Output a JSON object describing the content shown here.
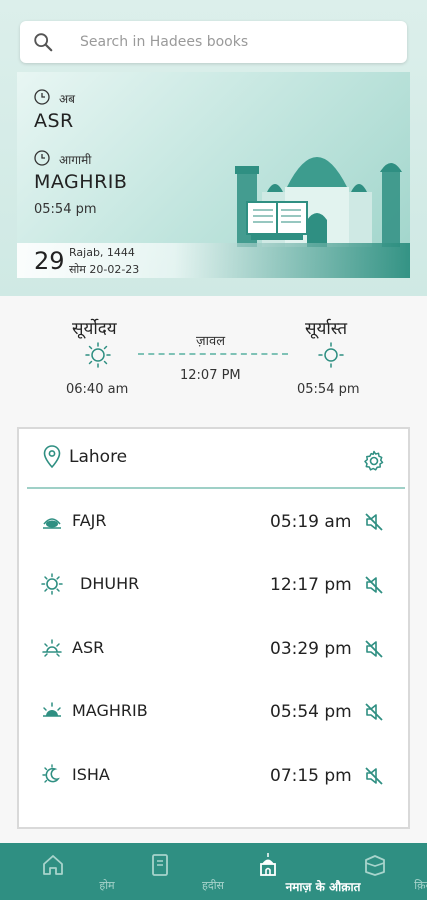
{
  "search": {
    "placeholder": "Search in Hadees books"
  },
  "card": {
    "now_label": "अब",
    "now_prayer": "ASR",
    "next_label": "आगामी",
    "next_prayer": "MAGHRIB",
    "next_time": "05:54 pm",
    "day": "29",
    "hijri": "Rajab, 1444",
    "gregorian": "सोम 20-02-23"
  },
  "sun": {
    "sunrise_label": "सूर्योदय",
    "sunrise_time": "06:40 am",
    "zawal_label": "ज़ावल",
    "zawal_time": "12:07 PM",
    "sunset_label": "सूर्यास्त",
    "sunset_time": "05:54 pm"
  },
  "location": {
    "name": "Lahore"
  },
  "prayers": [
    {
      "name": "FAJR",
      "time": "05:19 am",
      "icon": "fajr-icon"
    },
    {
      "name": "DHUHR",
      "time": "12:17 pm",
      "icon": "dhuhr-icon"
    },
    {
      "name": "ASR",
      "time": "03:29 pm",
      "icon": "asr-icon"
    },
    {
      "name": "MAGHRIB",
      "time": "05:54 pm",
      "icon": "maghrib-icon"
    },
    {
      "name": "ISHA",
      "time": "07:15 pm",
      "icon": "isha-icon"
    }
  ],
  "nav": [
    {
      "label": "होम",
      "icon": "home-icon"
    },
    {
      "label": "हदीस",
      "icon": "book-icon"
    },
    {
      "label": "नमाज़ के औक़ात",
      "icon": "mosque-icon",
      "active": true
    },
    {
      "label": "क़िब्ला",
      "icon": "kaaba-icon"
    }
  ],
  "colors": {
    "accent": "#2f8f82",
    "accent_light": "#7fc2b6"
  }
}
